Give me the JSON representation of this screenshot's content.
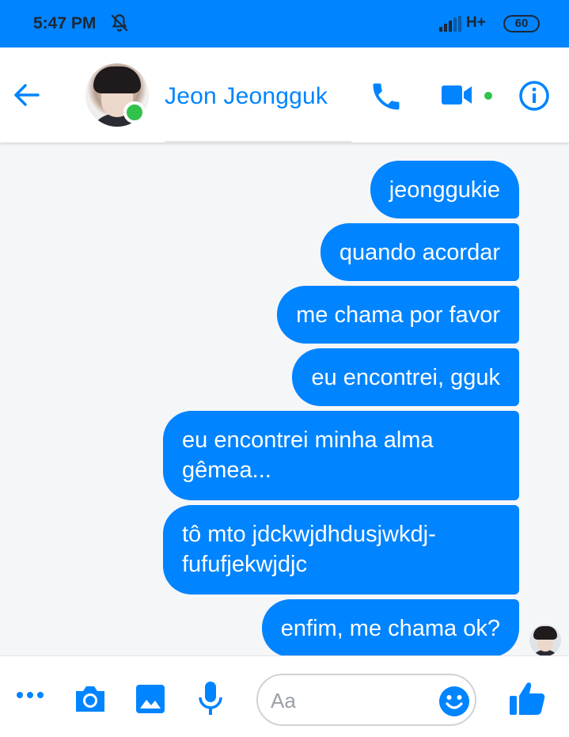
{
  "status_bar": {
    "time": "5:47 PM",
    "network": "H+",
    "battery": "60",
    "icons": [
      "mute-notifications-icon",
      "signal-icon",
      "battery-icon"
    ]
  },
  "header": {
    "contact_name": "Jeon Jeongguk",
    "online": true,
    "icons": [
      "back-arrow-icon",
      "phone-icon",
      "video-camera-icon",
      "info-icon"
    ]
  },
  "messages": [
    {
      "text": "jeonggukie"
    },
    {
      "text": "quando acordar"
    },
    {
      "text": "me chama por favor"
    },
    {
      "text": "eu encontrei, gguk"
    },
    {
      "text": "eu encontrei minha alma gêmea..."
    },
    {
      "text": "tô mto jdckwjdhdusjwkdj-fufufjekwjdjc"
    },
    {
      "text": "enfim, me chama ok?"
    }
  ],
  "composer": {
    "placeholder": "Aa",
    "icons": [
      "more-icon",
      "camera-icon",
      "gallery-icon",
      "microphone-icon",
      "emoji-icon",
      "thumbs-up-icon"
    ]
  },
  "colors": {
    "accent": "#0084ff",
    "online": "#31c24d",
    "background": "#f5f6f7"
  }
}
